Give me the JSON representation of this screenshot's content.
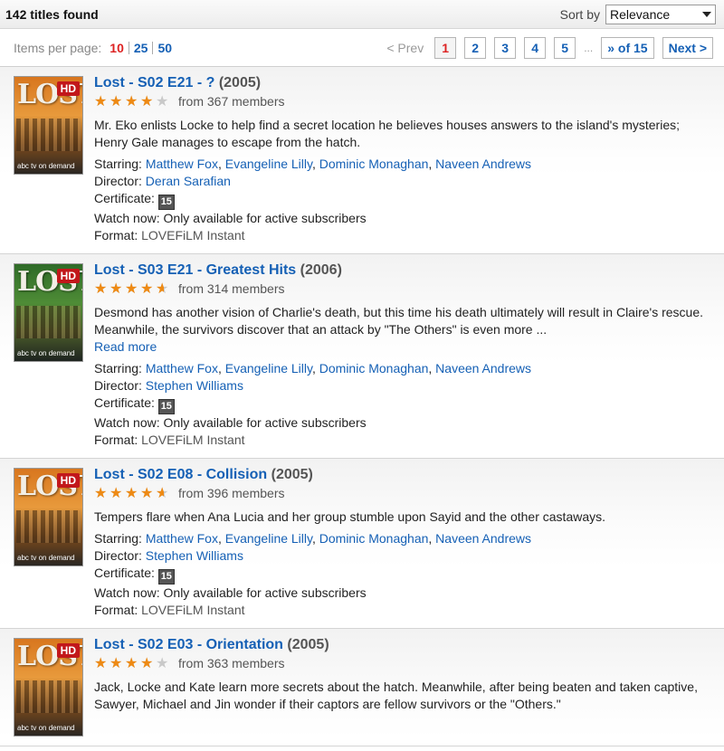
{
  "header": {
    "found": "142 titles found",
    "sort_label": "Sort by",
    "sort_value": "Relevance"
  },
  "pager": {
    "items_per_page_label": "Items per page:",
    "per_page_options": [
      "10",
      "25",
      "50"
    ],
    "per_page_selected": "10",
    "prev": "< Prev",
    "pages": [
      "1",
      "2",
      "3",
      "4",
      "5"
    ],
    "current_page": "1",
    "ellipsis": "...",
    "of_total": "» of 15",
    "next": "Next >"
  },
  "labels": {
    "starring": "Starring:",
    "director": "Director:",
    "certificate": "Certificate:",
    "watch_now": "Watch now:",
    "format": "Format:",
    "read_more": "Read more"
  },
  "items": [
    {
      "title": "Lost - S02 E21 - ?",
      "year": "(2005)",
      "rating": 4,
      "members": "from 367 members",
      "description": "Mr. Eko enlists Locke to help find a secret location he believes houses answers to the island's mysteries; Henry Gale manages to escape from the hatch.",
      "read_more": false,
      "starring": [
        "Matthew Fox",
        "Evangeline Lilly",
        "Dominic Monaghan",
        "Naveen Andrews"
      ],
      "director": "Deran Sarafian",
      "certificate": "15",
      "watch_now": "Only available for active subscribers",
      "format": "LOVEFiLM Instant",
      "poster_color": "orange"
    },
    {
      "title": "Lost - S03 E21 - Greatest Hits",
      "year": "(2006)",
      "rating": 4.5,
      "members": "from 314 members",
      "description": "Desmond has another vision of Charlie's death, but this time his death ultimately will result in Claire's rescue. Meanwhile, the survivors discover that an attack by \"The Others\" is even more ...",
      "read_more": true,
      "starring": [
        "Matthew Fox",
        "Evangeline Lilly",
        "Dominic Monaghan",
        "Naveen Andrews"
      ],
      "director": "Stephen Williams",
      "certificate": "15",
      "watch_now": "Only available for active subscribers",
      "format": "LOVEFiLM Instant",
      "poster_color": "green"
    },
    {
      "title": "Lost - S02 E08 - Collision",
      "year": "(2005)",
      "rating": 4.5,
      "members": "from 396 members",
      "description": "Tempers flare when Ana Lucia and her group stumble upon Sayid and the other castaways.",
      "read_more": false,
      "starring": [
        "Matthew Fox",
        "Evangeline Lilly",
        "Dominic Monaghan",
        "Naveen Andrews"
      ],
      "director": "Stephen Williams",
      "certificate": "15",
      "watch_now": "Only available for active subscribers",
      "format": "LOVEFiLM Instant",
      "poster_color": "orange"
    },
    {
      "title": "Lost - S02 E03 - Orientation",
      "year": "(2005)",
      "rating": 4,
      "members": "from 363 members",
      "description": "Jack, Locke and Kate learn more secrets about the hatch. Meanwhile, after being beaten and taken captive, Sawyer, Michael and Jin wonder if their captors are fellow survivors or the \"Others.\"",
      "read_more": false,
      "starring": [],
      "director": "",
      "certificate": "",
      "watch_now": "",
      "format": "",
      "poster_color": "orange"
    }
  ],
  "poster": {
    "logo": "LOST",
    "hd": "HD",
    "brand": "abc tv on demand"
  },
  "colors": {
    "link": "#1560b5",
    "star": "#ee8a14",
    "active": "#dd2222"
  }
}
